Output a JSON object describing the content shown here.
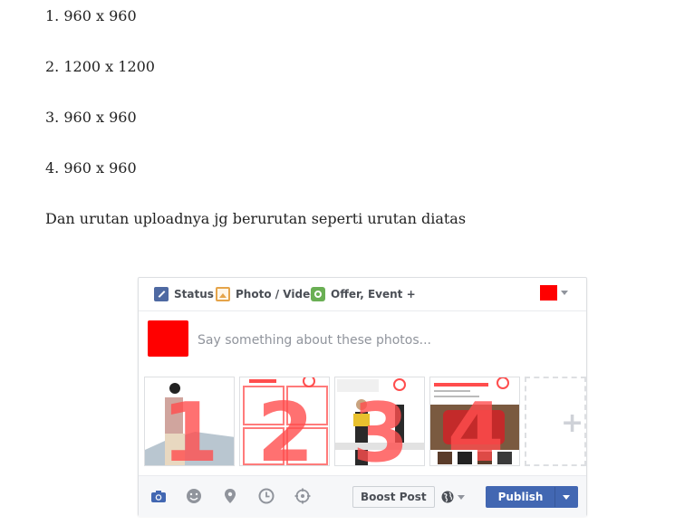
{
  "text_lines": [
    "1. 960 x 960",
    "2. 1200 x 1200",
    "3. 960 x 960",
    "4. 960 x 960",
    "Dan urutan uploadnya jg berurutan seperti urutan diatas"
  ],
  "composer": {
    "tabs": {
      "status": "Status",
      "photo": "Photo / Video",
      "offer": "Offer, Event +"
    },
    "placeholder": "Say something about these photos...",
    "thumbnails": [
      {
        "number": "1"
      },
      {
        "number": "2"
      },
      {
        "number": "3"
      },
      {
        "number": "4"
      }
    ],
    "add_photo_symbol": "+",
    "footer": {
      "icons": [
        "camera-icon",
        "emoji-icon",
        "location-icon",
        "clock-icon",
        "target-icon"
      ],
      "boost_label": "Boost Post",
      "publish_label": "Publish"
    },
    "colors": {
      "accent": "#4267b2",
      "redaction": "#ff0000",
      "number_overlay": "#ff4d4d"
    }
  }
}
